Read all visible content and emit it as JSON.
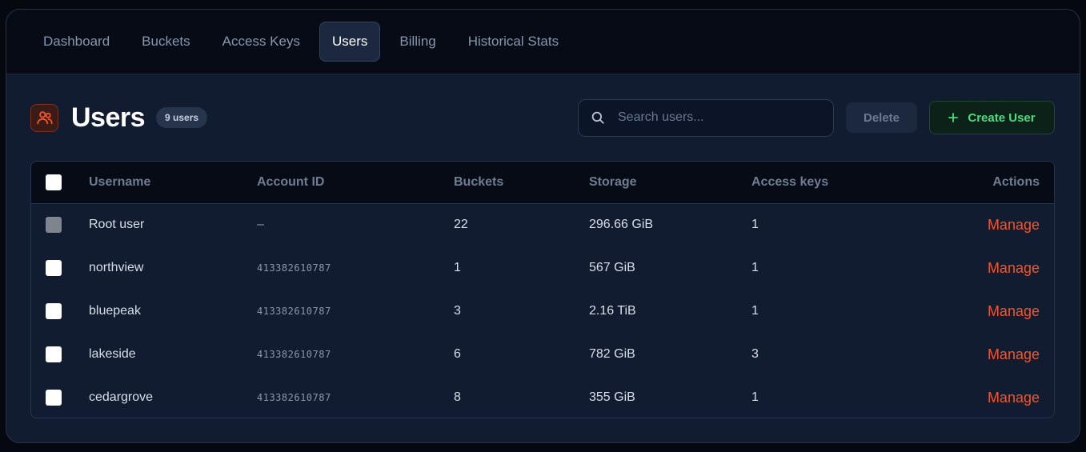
{
  "nav": {
    "tabs": [
      {
        "label": "Dashboard",
        "active": false
      },
      {
        "label": "Buckets",
        "active": false
      },
      {
        "label": "Access Keys",
        "active": false
      },
      {
        "label": "Users",
        "active": true
      },
      {
        "label": "Billing",
        "active": false
      },
      {
        "label": "Historical Stats",
        "active": false
      }
    ]
  },
  "header": {
    "title": "Users",
    "count_badge": "9 users",
    "icon": "users-icon"
  },
  "search": {
    "placeholder": "Search users...",
    "value": ""
  },
  "toolbar": {
    "delete_label": "Delete",
    "create_label": "Create User",
    "create_icon": "plus-icon"
  },
  "table": {
    "columns": [
      "Username",
      "Account ID",
      "Buckets",
      "Storage",
      "Access keys",
      "Actions"
    ],
    "rows": [
      {
        "username": "Root user",
        "account_id": "–",
        "buckets": "22",
        "storage": "296.66 GiB",
        "access_keys": "1",
        "action": "Manage",
        "checkbox_disabled": true
      },
      {
        "username": "northview",
        "account_id": "413382610787",
        "buckets": "1",
        "storage": "567 GiB",
        "access_keys": "1",
        "action": "Manage",
        "checkbox_disabled": false
      },
      {
        "username": "bluepeak",
        "account_id": "413382610787",
        "buckets": "3",
        "storage": "2.16 TiB",
        "access_keys": "1",
        "action": "Manage",
        "checkbox_disabled": false
      },
      {
        "username": "lakeside",
        "account_id": "413382610787",
        "buckets": "6",
        "storage": "782 GiB",
        "access_keys": "3",
        "action": "Manage",
        "checkbox_disabled": false
      },
      {
        "username": "cedargrove",
        "account_id": "413382610787",
        "buckets": "8",
        "storage": "355 GiB",
        "access_keys": "1",
        "action": "Manage",
        "checkbox_disabled": false
      }
    ]
  },
  "colors": {
    "accent_orange": "#f0562c",
    "accent_green": "#4ade80",
    "background": "#111c31"
  }
}
